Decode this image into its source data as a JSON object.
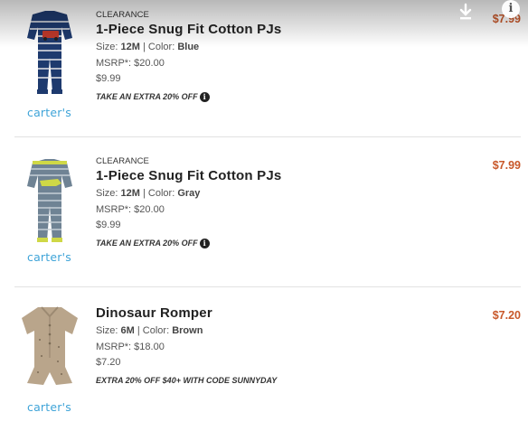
{
  "overlay": {
    "download_icon": "download-icon",
    "info_icon": "info-icon",
    "info_glyph": "i"
  },
  "items": [
    {
      "tag": "CLEARANCE",
      "name": "1-Piece Snug Fit Cotton PJs",
      "size_label": "Size:",
      "size": "12M",
      "color_label": "| Color:",
      "color": "Blue",
      "msrp": "MSRP*: $20.00",
      "sale": "$9.99",
      "promo": "TAKE AN EXTRA 20% OFF",
      "brand": "carter's",
      "price": "$7.99",
      "thumb_icon": "striped-pajama-image",
      "colors": {
        "body": "#1e3a6e",
        "stripe": "#e8e8e8",
        "accent": "#c0392b"
      }
    },
    {
      "tag": "CLEARANCE",
      "name": "1-Piece Snug Fit Cotton PJs",
      "size_label": "Size:",
      "size": "12M",
      "color_label": "| Color:",
      "color": "Gray",
      "msrp": "MSRP*: $20.00",
      "sale": "$9.99",
      "promo": "TAKE AN EXTRA 20% OFF",
      "brand": "carter's",
      "price": "$7.99",
      "thumb_icon": "dinosaur-pajama-image",
      "colors": {
        "body": "#6f8394",
        "stripe": "#c6cfd6",
        "accent": "#cfd846"
      }
    },
    {
      "tag": "",
      "name": "Dinosaur Romper",
      "size_label": "Size:",
      "size": "6M",
      "color_label": "| Color:",
      "color": "Brown",
      "msrp": "MSRP*: $18.00",
      "sale": "$7.20",
      "promo": "EXTRA 20% OFF $40+ WITH CODE SUNNYDAY",
      "brand": "carter's",
      "price": "$7.20",
      "thumb_icon": "romper-image",
      "colors": {
        "body": "#b9a58b",
        "stripe": "#9c8a72",
        "accent": "#7a6b55"
      }
    }
  ],
  "price_color": "#c8582a",
  "brand_color": "#3fa4d8"
}
